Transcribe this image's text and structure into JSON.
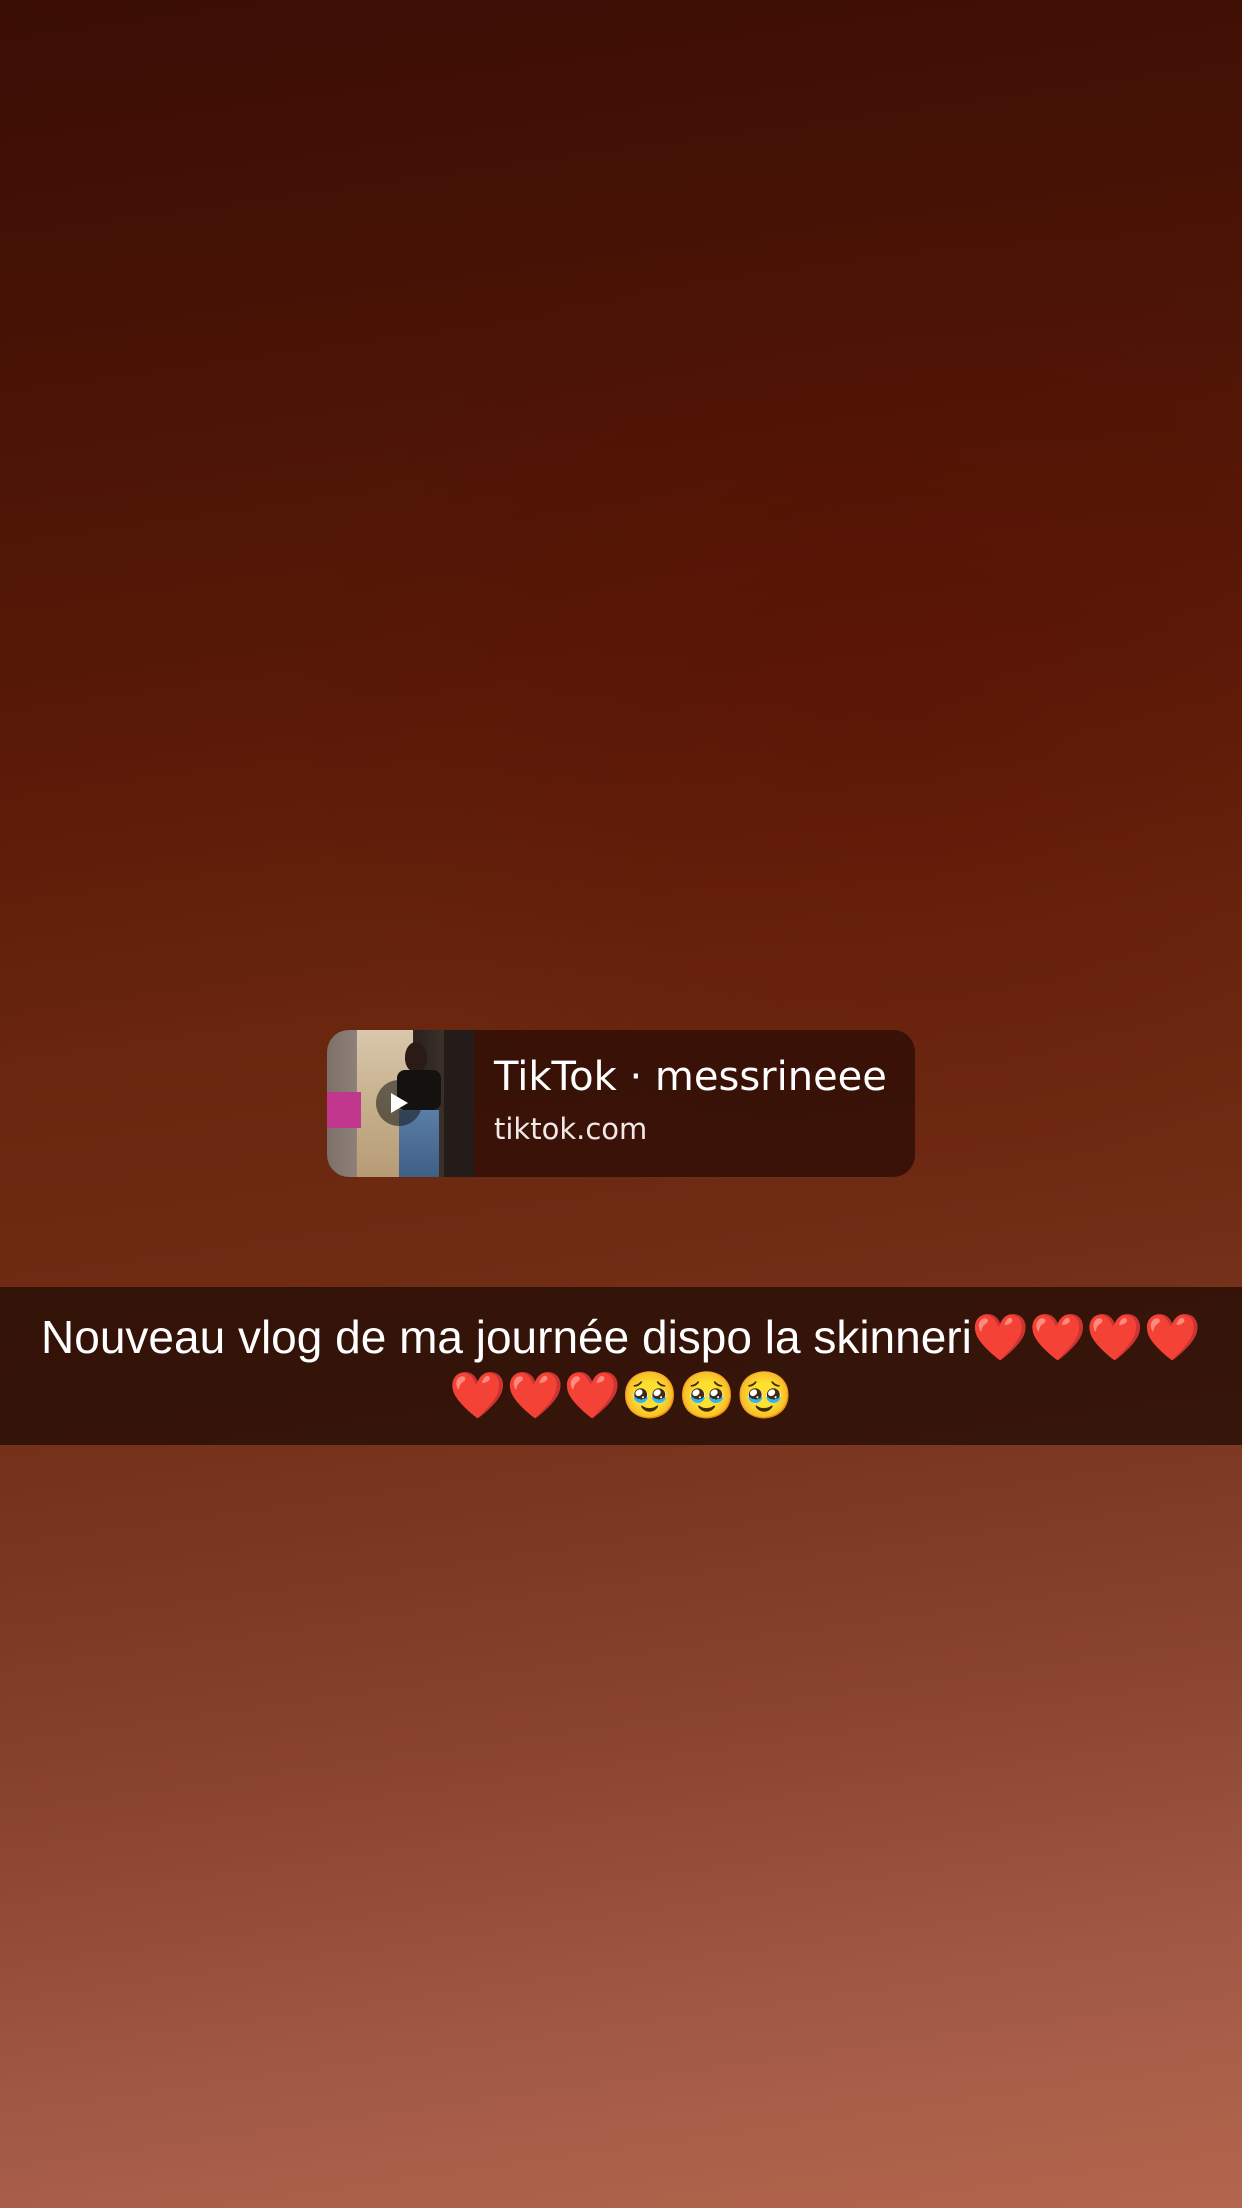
{
  "link_preview": {
    "title": "TikTok · messrineee",
    "domain": "tiktok.com",
    "thumbnail_icon": "play-icon"
  },
  "caption": {
    "text": "Nouveau vlog de ma journée dispo la skinneri❤️❤️❤️❤️❤️❤️❤️🥹🥹🥹"
  },
  "colors": {
    "background_top": "#3a0d05",
    "background_bottom": "#b3664d",
    "caption_bar": "#230c05",
    "card_background": "#2e0e06"
  }
}
